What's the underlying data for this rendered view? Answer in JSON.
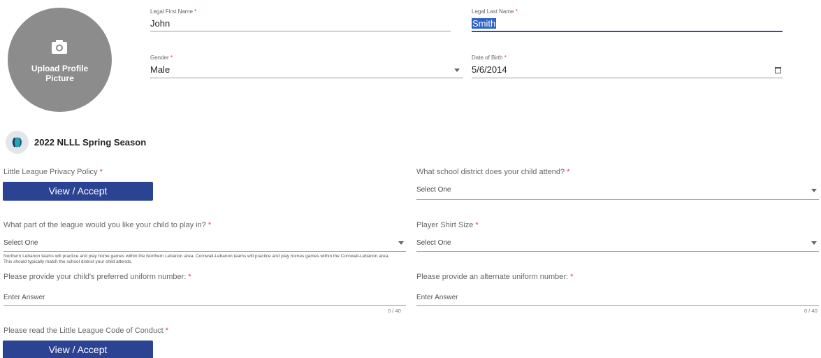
{
  "profile": {
    "upload_label_line1": "Upload Profile",
    "upload_label_line2": "Picture",
    "icon": "camera-icon"
  },
  "fields": {
    "first_name": {
      "label": "Legal First Name",
      "value": "John"
    },
    "last_name": {
      "label": "Legal Last Name",
      "value": "Smith"
    },
    "gender": {
      "label": "Gender",
      "value": "Male"
    },
    "dob": {
      "label": "Date of Birth",
      "value": "5/6/2014"
    },
    "required_mark": "*"
  },
  "season": {
    "title": "2022 NLLL Spring Season"
  },
  "questions": {
    "privacy": {
      "label": "Little League Privacy Policy",
      "button": "View / Accept"
    },
    "school_district": {
      "label": "What school district does your child attend?",
      "value": "Select One"
    },
    "league_part": {
      "label": "What part of the league would you like your child to play in?",
      "value": "Select One",
      "help": "Northern Lebanon teams will practice and play home games within the Northern Lebanon area. Cornwall-Lebanon teams will practice and play homes games within the Cornwall-Lebanon area. This should typically match the school district your child attends."
    },
    "shirt_size": {
      "label": "Player Shirt Size",
      "value": "Select One"
    },
    "uniform_number": {
      "label": "Please provide your child's preferred uniform number:",
      "placeholder": "Enter Answer",
      "counter": "0 / 40"
    },
    "alt_uniform_number": {
      "label": "Please provide an alternate uniform number:",
      "placeholder": "Enter Answer",
      "counter": "0 / 40"
    },
    "code_of_conduct": {
      "label": "Please read the Little League Code of Conduct",
      "button": "View / Accept"
    }
  },
  "colors": {
    "button_bg": "#2c4393",
    "focus_underline": "#3b4a9c",
    "required": "#e03a3a",
    "avatar_bg": "#8c8c8c"
  }
}
